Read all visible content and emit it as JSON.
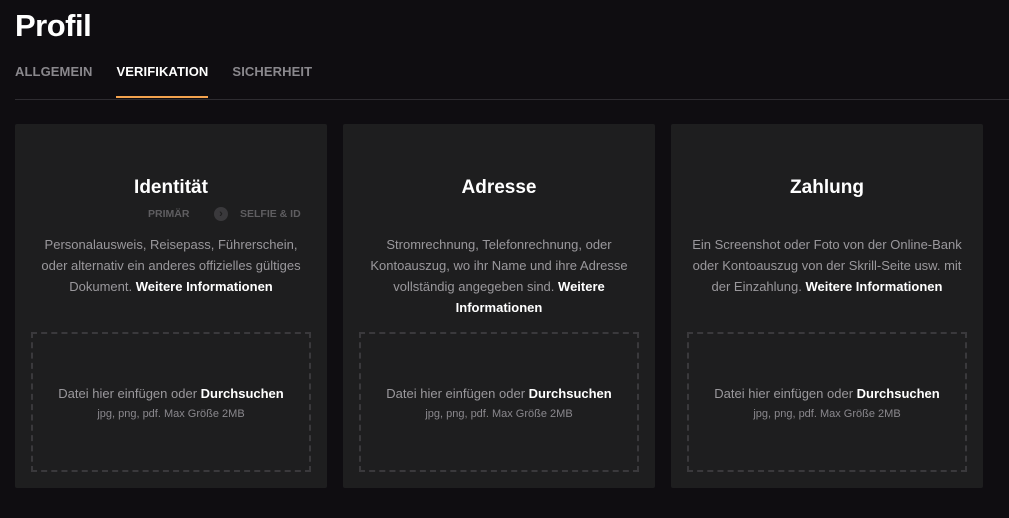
{
  "page": {
    "title": "Profil"
  },
  "tabs": [
    {
      "label": "ALLGEMEIN",
      "active": false
    },
    {
      "label": "VERIFIKATION",
      "active": true
    },
    {
      "label": "SICHERHEIT",
      "active": false
    }
  ],
  "colors": {
    "accent": "#f3a24e",
    "background": "#0f0d11",
    "card": "#1e1e1f"
  },
  "cards": [
    {
      "title": "Identität",
      "steps": {
        "primary": "PRIMÄR",
        "arrow_icon": "chevron-right-icon",
        "secondary": "SELFIE & ID"
      },
      "description": "Personalausweis, Reisepass, Führerschein, oder alternativ ein anderes offizielles gültiges Dokument.",
      "more_link": "Weitere Informationen",
      "drop_text": "Datei hier einfügen oder",
      "browse_link": "Durchsuchen",
      "drop_hint": "jpg, png, pdf. Max Größe 2MB"
    },
    {
      "title": "Adresse",
      "description": "Stromrechnung, Telefonrechnung, oder Kontoauszug, wo ihr Name und ihre Adresse vollständig angegeben sind.",
      "more_link": "Weitere Informationen",
      "drop_text": "Datei hier einfügen oder",
      "browse_link": "Durchsuchen",
      "drop_hint": "jpg, png, pdf. Max Größe 2MB"
    },
    {
      "title": "Zahlung",
      "description": "Ein Screenshot oder Foto von der Online-Bank oder Kontoauszug von der Skrill-Seite usw. mit der Einzahlung.",
      "more_link": "Weitere Informationen",
      "drop_text": "Datei hier einfügen oder",
      "browse_link": "Durchsuchen",
      "drop_hint": "jpg, png, pdf. Max Größe 2MB"
    }
  ]
}
